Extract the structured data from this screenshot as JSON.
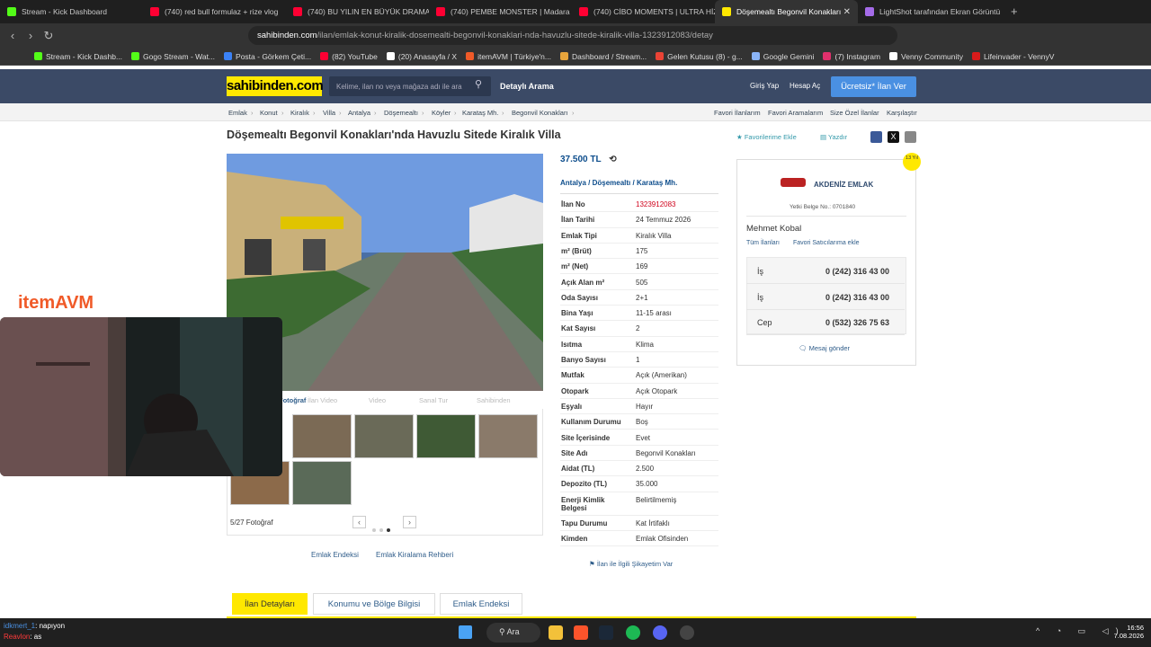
{
  "browser": {
    "tabs": [
      {
        "label": "Stream - Kick Dashboard",
        "color": "#53fc18"
      },
      {
        "label": "(740) red bull formulaz + rize vlog",
        "color": "#ff0033"
      },
      {
        "label": "(740) BU YILIN EN BÜYÜK DRAMAS",
        "color": "#ff0033"
      },
      {
        "label": "(740) PEMBE MONSTER | Madara C",
        "color": "#ff0033"
      },
      {
        "label": "(740) CİBO MOMENTS | ULTRA HİZ",
        "color": "#ff0033"
      },
      {
        "label": "Döşemealtı Begonvil Konakları",
        "color": "#ffe800",
        "active": true
      },
      {
        "label": "LightShot tarafından Ekran Görüntü",
        "color": "#a46be8"
      }
    ],
    "url_domain": "sahibinden.com",
    "url_path": "/ilan/emlak-konut-kiralik-dosemealti-begonvil-konaklari-nda-havuzlu-sitede-kiralik-villa-1323912083/detay",
    "bookmarks": [
      {
        "label": "Stream - Kick Dashb...",
        "color": "#53fc18"
      },
      {
        "label": "Gogo Stream - Wat...",
        "color": "#53fc18"
      },
      {
        "label": "Posta - Görkem Çeti...",
        "color": "#3b82f6"
      },
      {
        "label": "(82) YouTube",
        "color": "#ff0033"
      },
      {
        "label": "(20) Anasayfa / X",
        "color": "#ffffff"
      },
      {
        "label": "itemAVM | Türkiye'n...",
        "color": "#f05a28"
      },
      {
        "label": "Dashboard / Stream...",
        "color": "#e8a53c"
      },
      {
        "label": "Gelen Kutusu (8) - g...",
        "color": "#ea4335"
      },
      {
        "label": "Google Gemini",
        "color": "#8ab4f8"
      },
      {
        "label": "(7) Instagram",
        "color": "#e1306c"
      },
      {
        "label": "Venny Community",
        "color": "#ffffff"
      },
      {
        "label": "Lifeinvader - VennyV",
        "color": "#d81b1b"
      }
    ]
  },
  "site": {
    "logo": "sahibinden.com",
    "search_placeholder": "Kelime, ilan no veya mağaza adı ile ara",
    "detailed_search": "Detaylı Arama",
    "login": "Giriş Yap",
    "register": "Hesap Aç",
    "free_ad": "Ücretsiz* İlan Ver",
    "breadcrumb": [
      "Emlak",
      "Konut",
      "Kiralık",
      "Villa",
      "Antalya",
      "Döşemealtı",
      "Köyler",
      "Karataş Mh.",
      "Begonvil Konakları"
    ],
    "crumb_links": [
      "Favori İlanlarım",
      "Favori Aramalarım",
      "Size Özel İlanlar",
      "Karşılaştır"
    ]
  },
  "listing": {
    "title": "Döşemealtı Begonvil Konakları'nda Havuzlu Sitede Kiralık Villa",
    "fav_add": "Favorilerime Ekle",
    "print": "Yazdır",
    "price": "37.500 TL",
    "location": [
      "Antalya",
      "Döşemealtı",
      "Karataş Mh."
    ],
    "photo_counter": "5/27 Fotoğraf",
    "media_tabs": [
      "Fotoğraf",
      "İlan Video",
      "Video",
      "Sanal Tur",
      "Sahibinden"
    ],
    "links": [
      "Emlak Endeksi",
      "Emlak Kiralama Rehberi"
    ],
    "complaint": "İlan ile İlgili Şikayetim Var",
    "details": [
      {
        "k": "İlan No",
        "v": "1323912083",
        "red": true
      },
      {
        "k": "İlan Tarihi",
        "v": "24 Temmuz 2026"
      },
      {
        "k": "Emlak Tipi",
        "v": "Kiralık Villa"
      },
      {
        "k": "m² (Brüt)",
        "v": "175"
      },
      {
        "k": "m² (Net)",
        "v": "169"
      },
      {
        "k": "Açık Alan m²",
        "v": "505"
      },
      {
        "k": "Oda Sayısı",
        "v": "2+1"
      },
      {
        "k": "Bina Yaşı",
        "v": "11-15 arası"
      },
      {
        "k": "Kat Sayısı",
        "v": "2"
      },
      {
        "k": "Isıtma",
        "v": "Klima"
      },
      {
        "k": "Banyo Sayısı",
        "v": "1"
      },
      {
        "k": "Mutfak",
        "v": "Açık (Amerikan)"
      },
      {
        "k": "Otopark",
        "v": "Açık Otopark"
      },
      {
        "k": "Eşyalı",
        "v": "Hayır"
      },
      {
        "k": "Kullanım Durumu",
        "v": "Boş"
      },
      {
        "k": "Site İçerisinde",
        "v": "Evet"
      },
      {
        "k": "Site Adı",
        "v": "Begonvil Konakları"
      },
      {
        "k": "Aidat (TL)",
        "v": "2.500"
      },
      {
        "k": "Depozito (TL)",
        "v": "35.000"
      },
      {
        "k": "Enerji Kimlik Belgesi",
        "v": "Belirtilmemiş"
      },
      {
        "k": "Tapu Durumu",
        "v": "Kat İrtifaklı"
      },
      {
        "k": "Kimden",
        "v": "Emlak Ofisinden"
      }
    ],
    "bottom_tabs": [
      "İlan Detayları",
      "Konumu ve Bölge Bilgisi",
      "Emlak Endeksi"
    ]
  },
  "seller": {
    "badge": "13 Yıl",
    "agency": "AKDENİZ EMLAK",
    "license": "Yetki Belge No.: 0701840",
    "name": "Mehmet Kobal",
    "all_ads": "Tüm İlanları",
    "fav_seller": "Favori Satıcılarıma ekle",
    "phones": [
      {
        "type": "İş",
        "number": "0 (242) 316 43 00"
      },
      {
        "type": "İş",
        "number": "0 (242) 316 43 00"
      },
      {
        "type": "Cep",
        "number": "0 (532) 326 75 63"
      }
    ],
    "message": "Mesaj gönder"
  },
  "overlay": {
    "itemavm": "itemAVM",
    "chat": [
      {
        "user": "idkmert_1",
        "msg": ": napıyon",
        "color": "#4a90e2"
      },
      {
        "user": "Reavlon",
        "msg": ": as",
        "color": "#ff3b3b"
      }
    ]
  },
  "taskbar": {
    "search": "Ara",
    "time": "16:56",
    "date": "7.08.2026"
  }
}
